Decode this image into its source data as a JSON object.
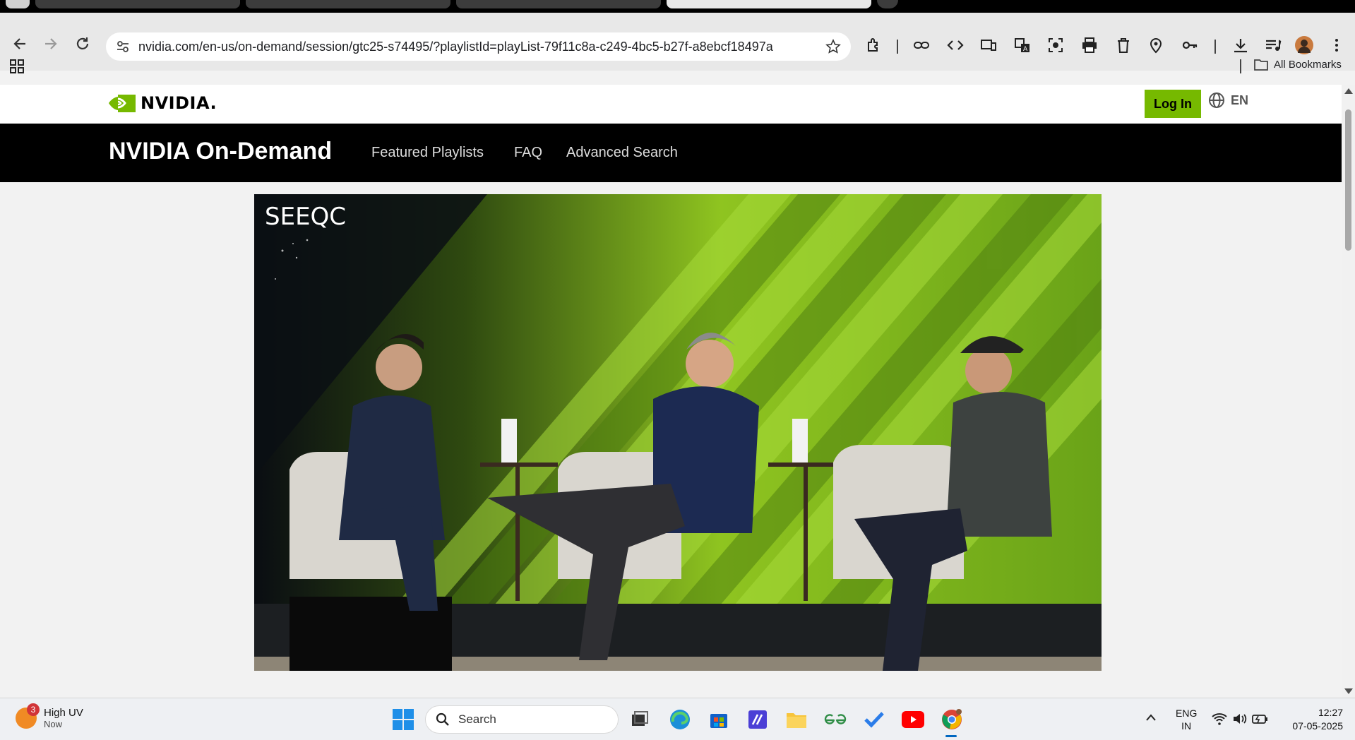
{
  "browser": {
    "url": "nvidia.com/en-us/on-demand/session/gtc25-s74495/?playlistId=playList-79f11c8a-c249-4bc5-b27f-a8ebcf18497a",
    "bookmarks_label": "All Bookmarks"
  },
  "site": {
    "logo_text": "NVIDIA.",
    "login_label": "Log In",
    "language": "EN",
    "title": "NVIDIA On-Demand",
    "nav": [
      "Featured Playlists",
      "FAQ",
      "Advanced Search"
    ],
    "brand_color": "#76b900"
  },
  "video": {
    "caption": "SEEQC"
  },
  "taskbar": {
    "weather_badge": "3",
    "weather_title": "High UV",
    "weather_sub": "Now",
    "search_placeholder": "Search",
    "lang_top": "ENG",
    "lang_bottom": "IN",
    "time": "12:27",
    "date": "07-05-2025"
  }
}
